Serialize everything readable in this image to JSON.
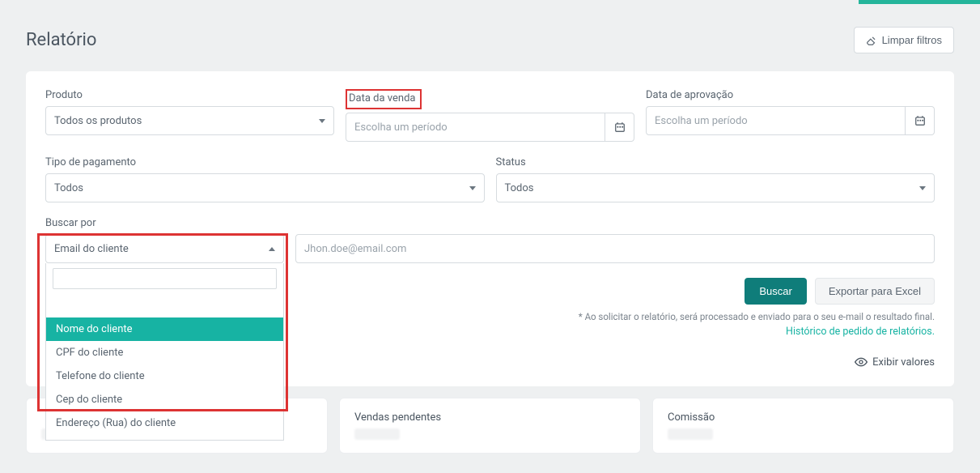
{
  "header": {
    "title": "Relatório",
    "clear_filters": "Limpar filtros"
  },
  "filters": {
    "product": {
      "label": "Produto",
      "value": "Todos os produtos"
    },
    "sale_date": {
      "label": "Data da venda",
      "placeholder": "Escolha um período"
    },
    "approval_date": {
      "label": "Data de aprovação",
      "placeholder": "Escolha um período"
    },
    "payment_type": {
      "label": "Tipo de pagamento",
      "value": "Todos"
    },
    "status": {
      "label": "Status",
      "value": "Todos"
    },
    "search_by": {
      "label": "Buscar por",
      "value": "Email do cliente",
      "options": [
        "Nome do cliente",
        "CPF do cliente",
        "Telefone do cliente",
        "Cep do cliente",
        "Endereço (Rua) do cliente"
      ]
    },
    "search_term": {
      "placeholder": "Jhon.doe@email.com"
    }
  },
  "actions": {
    "search": "Buscar",
    "export": "Exportar para Excel",
    "note": "* Ao solicitar o relatório, será processado e enviado para o seu e-mail o resultado final.",
    "history_link": "Histórico de pedido de relatórios.",
    "show_values": "Exibir valores"
  },
  "stats": {
    "pending": "Vendas pendentes",
    "commission": "Comissão"
  }
}
